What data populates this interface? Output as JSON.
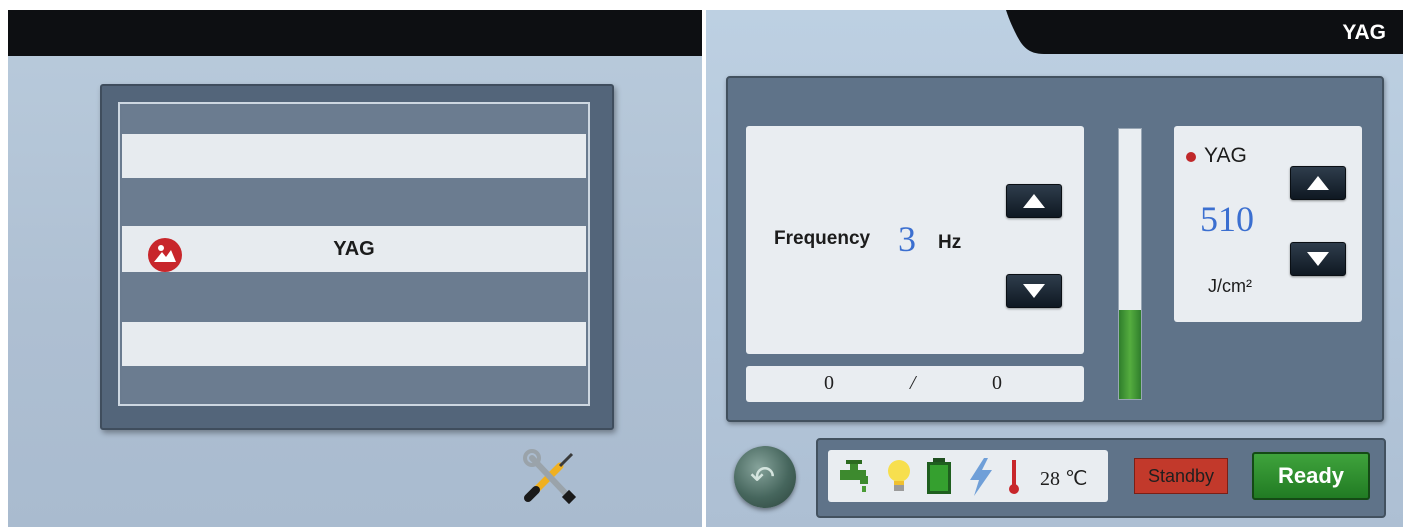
{
  "left_screen": {
    "mode_list": [
      {
        "label": ""
      },
      {
        "label": ""
      },
      {
        "label": ""
      },
      {
        "label": "YAG",
        "selected": true,
        "icon": "laser-mode-icon"
      },
      {
        "label": ""
      },
      {
        "label": ""
      },
      {
        "label": ""
      }
    ],
    "settings_icon": "tools-icon"
  },
  "right_screen": {
    "title": "YAG",
    "frequency": {
      "label": "Frequency",
      "value": "3",
      "unit": "Hz"
    },
    "counter": {
      "current": "0",
      "separator": "/",
      "total": "0"
    },
    "level_fraction": 0.33,
    "energy": {
      "mode_label": "YAG",
      "value": "510",
      "unit": "J/cm²"
    },
    "status": {
      "icons": [
        "water-flow-icon",
        "lamp-icon",
        "battery-icon",
        "power-icon",
        "thermometer-icon"
      ],
      "temperature": "28 ℃",
      "standby_label": "Standby",
      "ready_label": "Ready"
    }
  },
  "colors": {
    "accent_blue": "#3b6fd0",
    "standby_red": "#c2392b",
    "ready_green": "#2f8e2f",
    "panel": "#5f7389"
  }
}
